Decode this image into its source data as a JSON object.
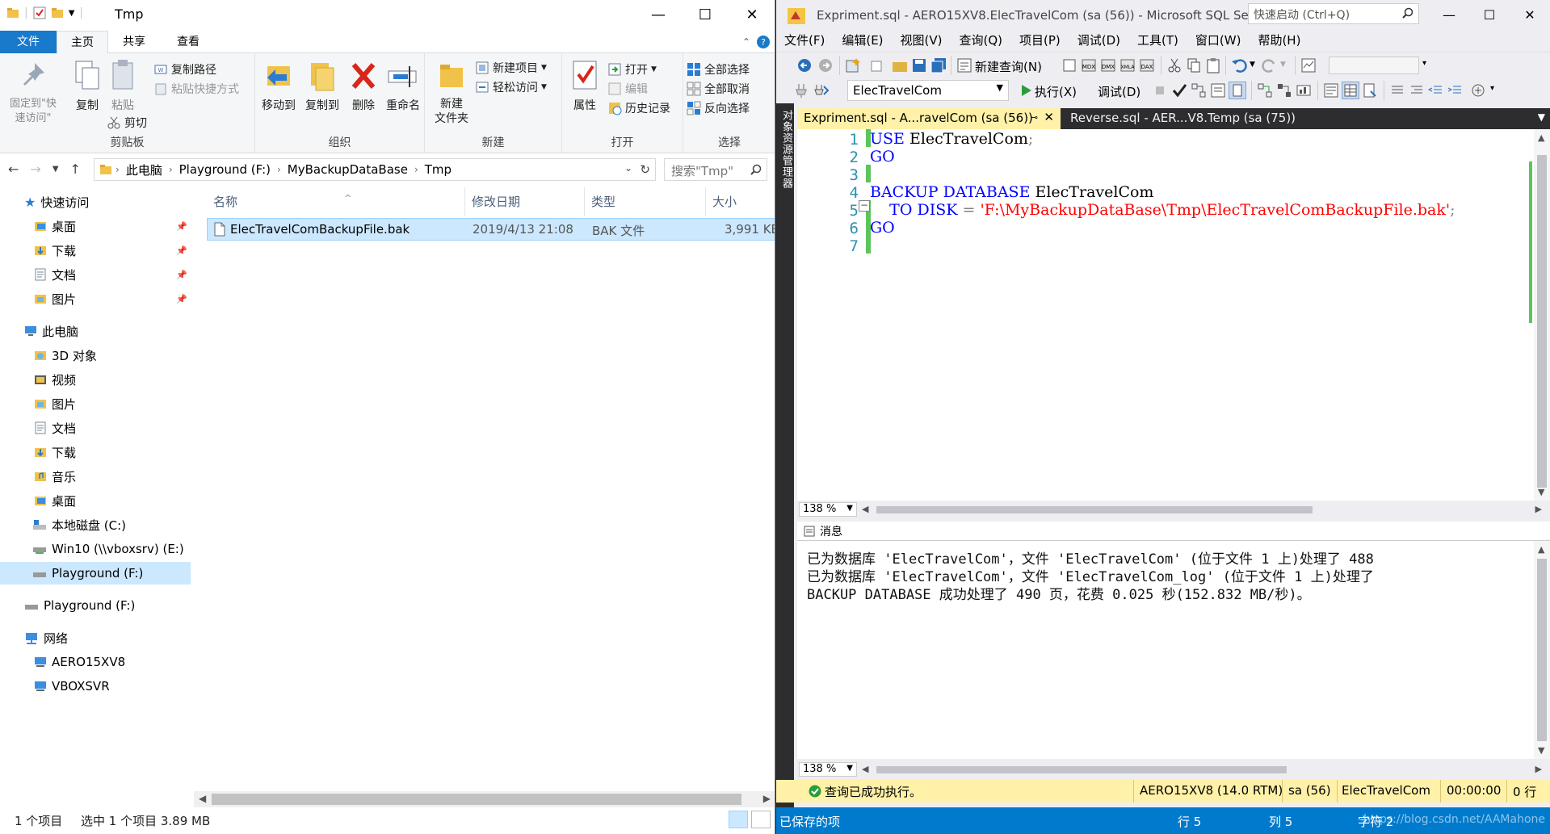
{
  "explorer": {
    "title": "Tmp",
    "tabs": {
      "file": "文件",
      "home": "主页",
      "share": "共享",
      "view": "查看"
    },
    "ribbon": {
      "clipboard": {
        "label": "剪贴板",
        "pin_quick_access": "固定到\"快速访问\"",
        "copy": "复制",
        "paste": "粘贴",
        "copy_path": "复制路径",
        "paste_shortcut": "粘贴快捷方式",
        "cut": "剪切"
      },
      "organize": {
        "label": "组织",
        "move_to": "移动到",
        "copy_to": "复制到",
        "delete": "删除",
        "rename": "重命名"
      },
      "new": {
        "label": "新建",
        "new_folder_line1": "新建",
        "new_folder_line2": "文件夹",
        "new_item": "新建项目",
        "easy_access": "轻松访问"
      },
      "open": {
        "label": "打开",
        "properties": "属性",
        "open": "打开",
        "edit": "编辑",
        "history": "历史记录"
      },
      "select": {
        "label": "选择",
        "select_all": "全部选择",
        "select_none": "全部取消",
        "invert": "反向选择"
      }
    },
    "address": {
      "crumbs": [
        "此电脑",
        "Playground (F:)",
        "MyBackupDataBase",
        "Tmp"
      ],
      "search_placeholder": "搜索\"Tmp\""
    },
    "nav": {
      "quick_access": "快速访问",
      "qa_items": [
        "桌面",
        "下载",
        "文档",
        "图片"
      ],
      "this_pc": "此电脑",
      "pc_items": [
        "3D 对象",
        "视频",
        "图片",
        "文档",
        "下载",
        "音乐",
        "桌面"
      ],
      "drives": [
        "本地磁盘 (C:)",
        "Win10 (\\\\vboxsrv) (E:)",
        "Playground (F:)"
      ],
      "playground_root": "Playground (F:)",
      "network": "网络",
      "network_items": [
        "AERO15XV8",
        "VBOXSVR"
      ]
    },
    "columns": {
      "name": "名称",
      "modified": "修改日期",
      "type": "类型",
      "size": "大小"
    },
    "files": [
      {
        "name": "ElecTravelComBackupFile.bak",
        "modified": "2019/4/13 21:08",
        "type": "BAK 文件",
        "size": "3,991 KB"
      }
    ],
    "status": {
      "count": "1 个项目",
      "selected": "选中 1 个项目  3.89 MB"
    }
  },
  "ssms": {
    "title": "Expriment.sql - AERO15XV8.ElecTravelCom (sa (56)) - Microsoft SQL Se...",
    "quick_launch_placeholder": "快速启动 (Ctrl+Q)",
    "menu": [
      "文件(F)",
      "编辑(E)",
      "视图(V)",
      "查询(Q)",
      "项目(P)",
      "调试(D)",
      "工具(T)",
      "窗口(W)",
      "帮助(H)"
    ],
    "toolbar": {
      "new_query": "新建查询(N)",
      "database": "ElecTravelCom",
      "execute": "执行(X)",
      "debug": "调试(D)"
    },
    "object_explorer_tab": "对象资源管理器",
    "doc_tabs": [
      {
        "label": "Expriment.sql - A...ravelCom (sa (56))",
        "active": true
      },
      {
        "label": "Reverse.sql - AER...V8.Temp (sa (75))",
        "active": false
      }
    ],
    "code_lines": [
      {
        "num": "1",
        "parts": [
          [
            "kw",
            "USE"
          ],
          [
            "id",
            " ElecTravelCom"
          ],
          [
            "op",
            ";"
          ]
        ]
      },
      {
        "num": "2",
        "parts": [
          [
            "kw",
            "GO"
          ]
        ]
      },
      {
        "num": "3",
        "parts": []
      },
      {
        "num": "4",
        "parts": [
          [
            "kw",
            "BACKUP"
          ],
          [
            "id",
            " "
          ],
          [
            "kw",
            "DATABASE"
          ],
          [
            "id",
            " ElecTravelCom"
          ]
        ]
      },
      {
        "num": "5",
        "parts": [
          [
            "id",
            "    "
          ],
          [
            "kw",
            "TO"
          ],
          [
            "id",
            " "
          ],
          [
            "kw",
            "DISK"
          ],
          [
            "id",
            " "
          ],
          [
            "op",
            "="
          ],
          [
            "id",
            " "
          ],
          [
            "str",
            "'F:\\MyBackupDataBase\\Tmp\\ElecTravelComBackupFile.bak'"
          ],
          [
            "op",
            ";"
          ]
        ]
      },
      {
        "num": "6",
        "parts": [
          [
            "kw",
            "GO"
          ]
        ]
      },
      {
        "num": "7",
        "parts": []
      }
    ],
    "zoom": "138 %",
    "messages_tab": "消息",
    "messages": [
      "已为数据库 'ElecTravelCom'，文件 'ElecTravelCom' (位于文件 1 上)处理了 488",
      "已为数据库 'ElecTravelCom'，文件 'ElecTravelCom_log' (位于文件 1 上)处理了",
      "BACKUP DATABASE 成功处理了 490 页，花费 0.025 秒(152.832 MB/秒)。"
    ],
    "query_status": {
      "message": "查询已成功执行。",
      "server": "AERO15XV8 (14.0 RTM)",
      "user": "sa (56)",
      "database": "ElecTravelCom",
      "time": "00:00:00",
      "rows": "0 行"
    },
    "status": {
      "saved": "已保存的项",
      "line": "行 5",
      "col": "列 5",
      "char": "字符 2",
      "watermark": "https://blog.csdn.net/AAMahone"
    }
  }
}
